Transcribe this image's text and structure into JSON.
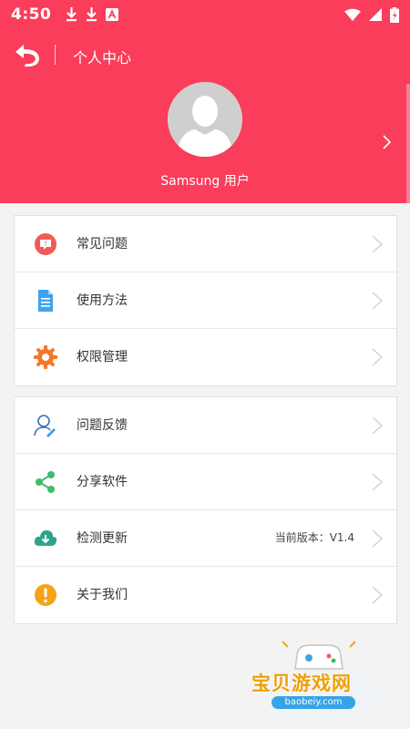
{
  "status_bar": {
    "time": "4:50"
  },
  "topbar": {
    "title": "个人中心"
  },
  "profile": {
    "username": "Samsung 用户"
  },
  "menu_group_1": [
    {
      "label": "常见问题",
      "icon": "faq-icon"
    },
    {
      "label": "使用方法",
      "icon": "document-icon"
    },
    {
      "label": "权限管理",
      "icon": "gear-icon"
    }
  ],
  "menu_group_2": [
    {
      "label": "问题反馈",
      "icon": "feedback-icon"
    },
    {
      "label": "分享软件",
      "icon": "share-icon"
    },
    {
      "label": "检测更新",
      "icon": "cloud-download-icon",
      "value": "当前版本：V1.4"
    },
    {
      "label": "关于我们",
      "icon": "info-icon"
    }
  ],
  "watermark": {
    "title": "宝贝游戏网",
    "url": "baobeiy.com"
  },
  "colors": {
    "header": "#f93d5a",
    "background": "#f3f3f3"
  }
}
